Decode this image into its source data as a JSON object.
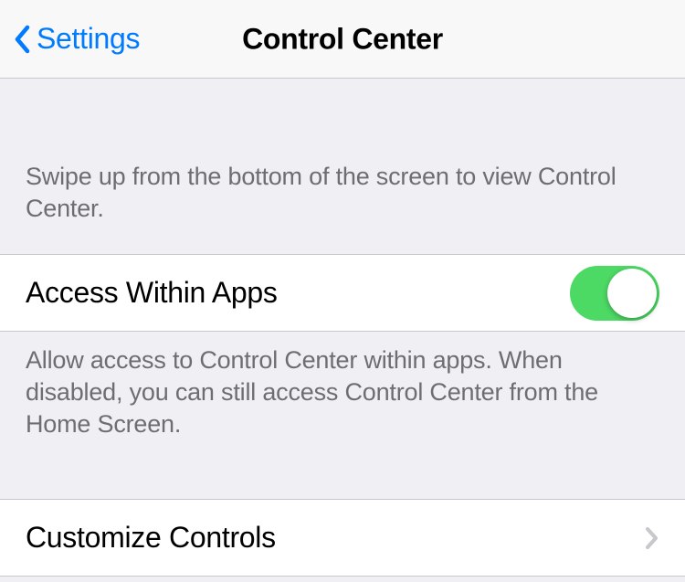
{
  "nav": {
    "back_label": "Settings",
    "title": "Control Center"
  },
  "sections": {
    "intro_text": "Swipe up from the bottom of the screen to view Control Center.",
    "access_row": {
      "label": "Access Within Apps",
      "toggle_on": true
    },
    "access_footer": "Allow access to Control Center within apps. When disabled, you can still access Control Center from the Home Screen.",
    "customize_row": {
      "label": "Customize Controls"
    }
  }
}
